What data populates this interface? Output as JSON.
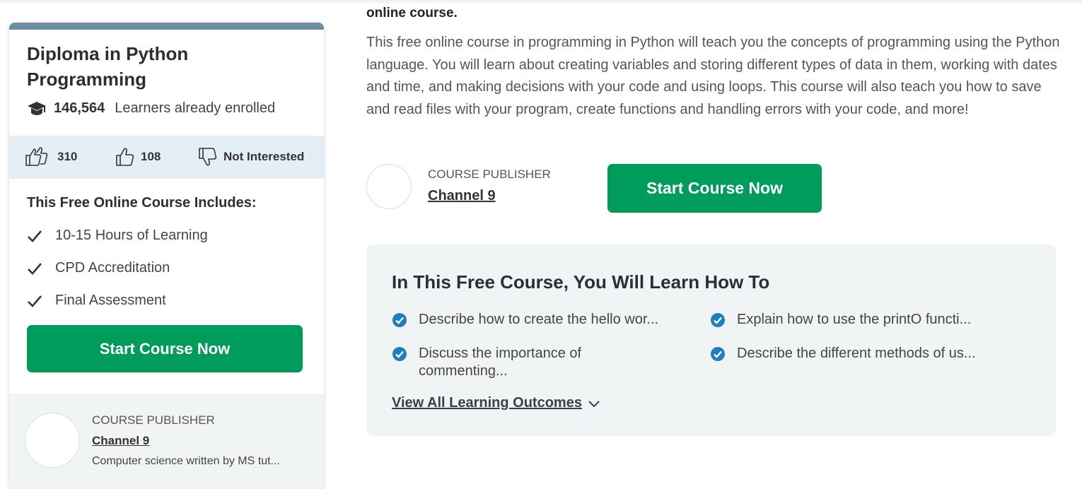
{
  "card": {
    "title": "Diploma in Python Programming",
    "enrolled_count": "146,564",
    "enrolled_label": "Learners already enrolled",
    "ratings": {
      "love_count": "310",
      "like_count": "108",
      "not_interested_label": "Not Interested"
    },
    "includes_title": "This Free Online Course Includes:",
    "includes": [
      "10-15 Hours of Learning",
      "CPD Accreditation",
      "Final Assessment"
    ],
    "start_button": "Start Course Now",
    "publisher": {
      "label": "COURSE PUBLISHER",
      "name": "Channel 9",
      "description": "Computer science written by MS tut..."
    }
  },
  "main": {
    "lead_bold": "online course.",
    "description": "This free online course in programming in Python will teach you the concepts of programming using the Python language. You will learn about creating variables and storing different types of data in them, working with dates and time, and making decisions with your code and using loops. This course will also teach you how to save and read files with your program, create functions and handling errors with your code, and more!",
    "publisher": {
      "label": "COURSE PUBLISHER",
      "name": "Channel 9"
    },
    "start_button": "Start Course Now",
    "learn": {
      "title": "In This Free Course, You Will Learn How To",
      "outcomes": [
        "Describe how to create the hello wor...",
        "Explain how to use the printO functi...",
        "Discuss the importance of commenting...",
        "Describe the different methods of us..."
      ],
      "view_all": "View All Learning Outcomes"
    }
  },
  "colors": {
    "accent_green": "#009c5c",
    "card_topbar": "#6b8ea3",
    "rating_bg": "#e4eff5",
    "panel_bg": "#f1f4f5",
    "check_blue": "#1f7fb8"
  },
  "icons": [
    "graduation-cap-icon",
    "double-thumbs-up-icon",
    "thumbs-up-icon",
    "thumbs-down-icon",
    "checkmark-icon",
    "check-circle-icon",
    "chevron-down-icon"
  ]
}
